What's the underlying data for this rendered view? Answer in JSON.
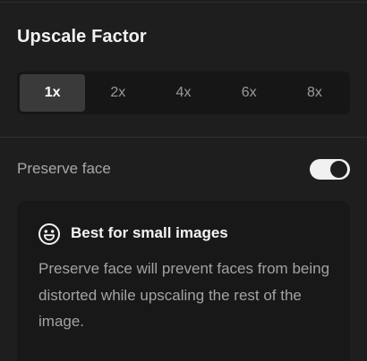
{
  "upscale": {
    "title": "Upscale Factor",
    "options": [
      "1x",
      "2x",
      "4x",
      "6x",
      "8x"
    ],
    "selected": "1x"
  },
  "preserve_face": {
    "label": "Preserve face",
    "enabled": true
  },
  "info_card": {
    "icon": "smile-icon",
    "title": "Best for small images",
    "body": "Preserve face will prevent faces from being distorted while upscaling the rest of the image."
  },
  "colors": {
    "background": "#1e1e1e",
    "segment_bg": "#161616",
    "segment_active": "#3a3a3a",
    "toggle_on": "#f0f0f0",
    "card_bg": "#181818"
  }
}
